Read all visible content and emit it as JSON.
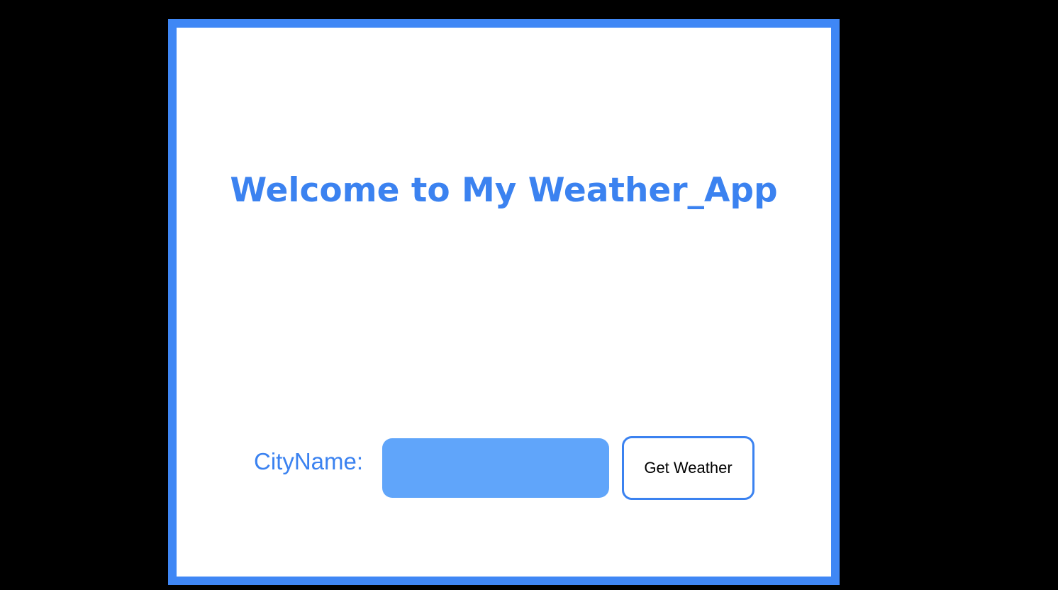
{
  "app": {
    "title": "Welcome to My Weather_App"
  },
  "form": {
    "city_label": "CityName:",
    "city_input_value": "",
    "city_input_placeholder": "",
    "submit_label": "Get Weather"
  },
  "colors": {
    "frame_border": "#3f87f5",
    "accent_text": "#3b82f0",
    "input_fill": "#60a5fa",
    "page_background": "#000000",
    "panel_background": "#ffffff"
  }
}
